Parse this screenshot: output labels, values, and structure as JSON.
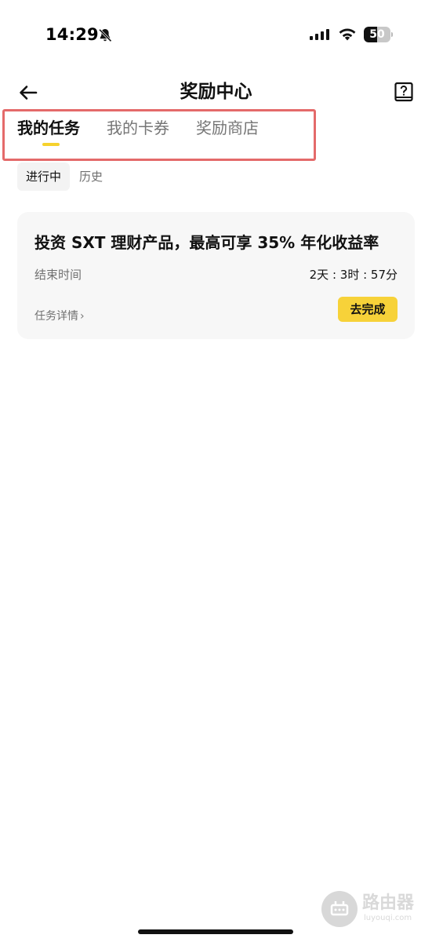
{
  "status_bar": {
    "time": "14:29",
    "battery": 50
  },
  "header": {
    "title": "奖励中心",
    "icons": [
      "back-arrow-icon",
      "help-book-icon"
    ]
  },
  "tabs": [
    {
      "label": "我的任务",
      "active": true
    },
    {
      "label": "我的卡券",
      "active": false
    },
    {
      "label": "奖励商店",
      "active": false
    }
  ],
  "subtabs": [
    {
      "label": "进行中",
      "active": true
    },
    {
      "label": "历史",
      "active": false
    }
  ],
  "task": {
    "title": "投资 SXT 理财产品，最高可享 35% 年化收益率",
    "end_label": "结束时间",
    "countdown": "2天 : 3时 : 57分",
    "details": "任务详情",
    "action": "去完成"
  },
  "watermark": {
    "title": "路由器",
    "subtitle": "luyouqi.com"
  },
  "colors": {
    "accent": "#F7D239",
    "underline": "#F6D22D",
    "highlight_box": "#E46A6A"
  }
}
